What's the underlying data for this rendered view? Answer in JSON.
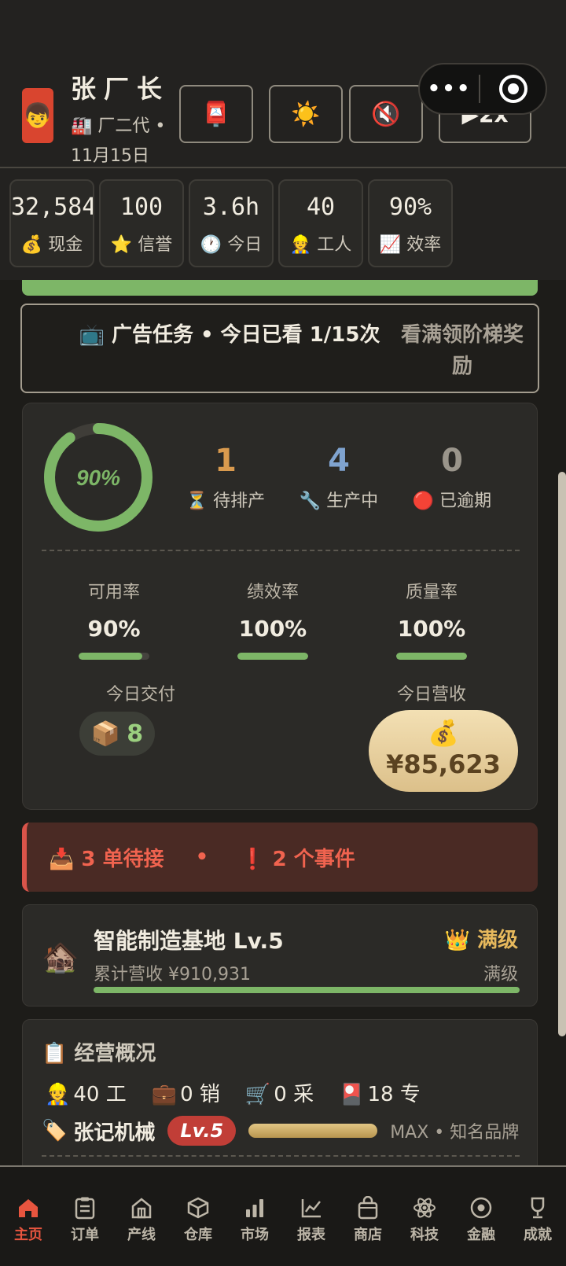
{
  "header": {
    "avatar": "👦",
    "name": "张厂长",
    "rank": "🏭 厂二代 •",
    "date": "11月15日",
    "buttons": {
      "mail": "📮",
      "brightness": "☀️",
      "mute": "🔇",
      "speed": "▶2x"
    },
    "capsule": {
      "more": "•••"
    }
  },
  "stats": [
    {
      "value": "32,584",
      "icon": "💰",
      "label": "现金"
    },
    {
      "value": "100",
      "icon": "⭐",
      "label": "信誉"
    },
    {
      "value": "3.6h",
      "icon": "🕐",
      "label": "今日"
    },
    {
      "value": "40",
      "icon": "👷",
      "label": "工人"
    },
    {
      "value": "90%",
      "icon": "📈",
      "label": "效率"
    }
  ],
  "ad": {
    "left": "📺 广告任务 • 今日已看 1/15次",
    "right": "看满领阶梯奖励"
  },
  "production": {
    "ring_percent": 90,
    "ring_label": "90%",
    "counts": [
      {
        "value": "1",
        "label": "⏳ 待排产",
        "color": "#d99a4e"
      },
      {
        "value": "4",
        "label": "🔧 生产中",
        "color": "#7fa3cf"
      },
      {
        "value": "0",
        "label": "🔴 已逾期",
        "color": "#9a958b"
      }
    ],
    "metrics": [
      {
        "label": "可用率",
        "value": "90%",
        "fill": 0.9
      },
      {
        "label": "绩效率",
        "value": "100%",
        "fill": 1.0
      },
      {
        "label": "质量率",
        "value": "100%",
        "fill": 1.0
      }
    ],
    "delivery_label": "今日交付",
    "delivery_icon": "📦",
    "delivery_value": "8",
    "revenue_label": "今日营收",
    "revenue_icon": "💰",
    "revenue_value": "¥85,623"
  },
  "alert": {
    "orders": "📥 3 单待接",
    "sep": "•",
    "events": "❗ 2 个事件"
  },
  "base": {
    "icon": "🏚️",
    "title": "智能制造基地 Lv.5",
    "badge": "👑 满级",
    "subtitle": "累计营收 ¥910,931",
    "status": "满级",
    "progress": 1.0
  },
  "overview": {
    "title": "📋 经营概况",
    "items": [
      {
        "icon": "👷",
        "text": "40 工"
      },
      {
        "icon": "💼",
        "text": "0 销"
      },
      {
        "icon": "🛒",
        "text": "0 采"
      },
      {
        "icon": "🎴",
        "text": "18 专"
      }
    ],
    "brand_icon": "🏷️",
    "brand_name": "张记机械",
    "brand_level": "Lv.5",
    "brand_progress": 1.0,
    "brand_meta": "MAX • 知名品牌"
  },
  "nav": [
    {
      "label": "主页",
      "icon": "home-icon",
      "active": true
    },
    {
      "label": "订单",
      "icon": "clipboard-icon",
      "active": false
    },
    {
      "label": "产线",
      "icon": "factory-icon",
      "active": false
    },
    {
      "label": "仓库",
      "icon": "box-icon",
      "active": false
    },
    {
      "label": "市场",
      "icon": "bar-chart-icon",
      "active": false
    },
    {
      "label": "报表",
      "icon": "line-chart-icon",
      "active": false
    },
    {
      "label": "商店",
      "icon": "shop-bag-icon",
      "active": false
    },
    {
      "label": "科技",
      "icon": "atom-icon",
      "active": false
    },
    {
      "label": "金融",
      "icon": "coin-icon",
      "active": false
    },
    {
      "label": "成就",
      "icon": "trophy-icon",
      "active": false
    }
  ],
  "colors": {
    "accent_green": "#7db667",
    "alert_red": "#f0634f",
    "gold": "#e6b85c",
    "nav_active": "#e8553f"
  }
}
